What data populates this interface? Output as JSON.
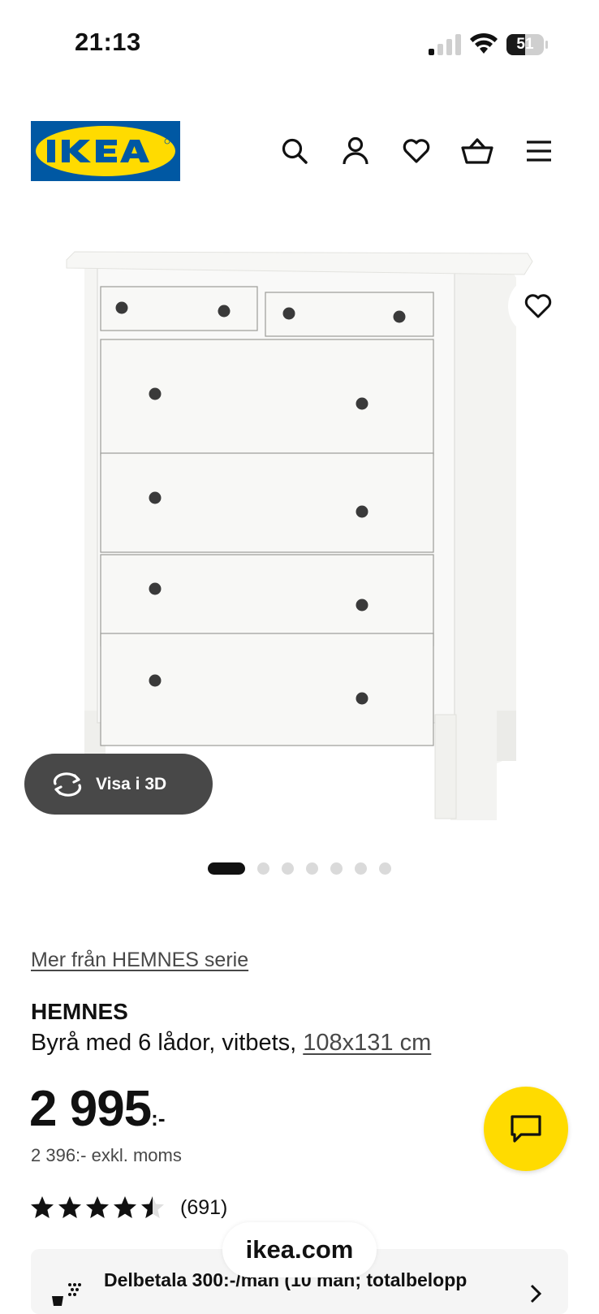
{
  "status_bar": {
    "time": "21:13",
    "battery_level": "51"
  },
  "header": {
    "logo_text": "IKEA",
    "icons": [
      "search-icon",
      "user-icon",
      "heart-icon",
      "cart-icon",
      "menu-icon"
    ]
  },
  "gallery": {
    "view_3d_label": "Visa i 3D",
    "image_count": 7,
    "active_index": 0
  },
  "product": {
    "series_link": "Mer från HEMNES serie",
    "name": "HEMNES",
    "description": "Byrå med 6 lådor, vitbets, ",
    "dimensions": "108x131 cm",
    "price": "2 995",
    "price_suffix": ":-",
    "price_excl_vat": "2 396:- exkl. moms",
    "rating_value": 4.5,
    "rating_max": 5,
    "review_count": "(691)"
  },
  "installment": {
    "text": "Delbetala 300:-/mån (10 mån; totalbelopp"
  },
  "browser": {
    "url": "ikea.com"
  },
  "colors": {
    "ikea_blue": "#0058a3",
    "ikea_yellow": "#ffdb00",
    "text": "#111111",
    "secondary_text": "#484848"
  }
}
